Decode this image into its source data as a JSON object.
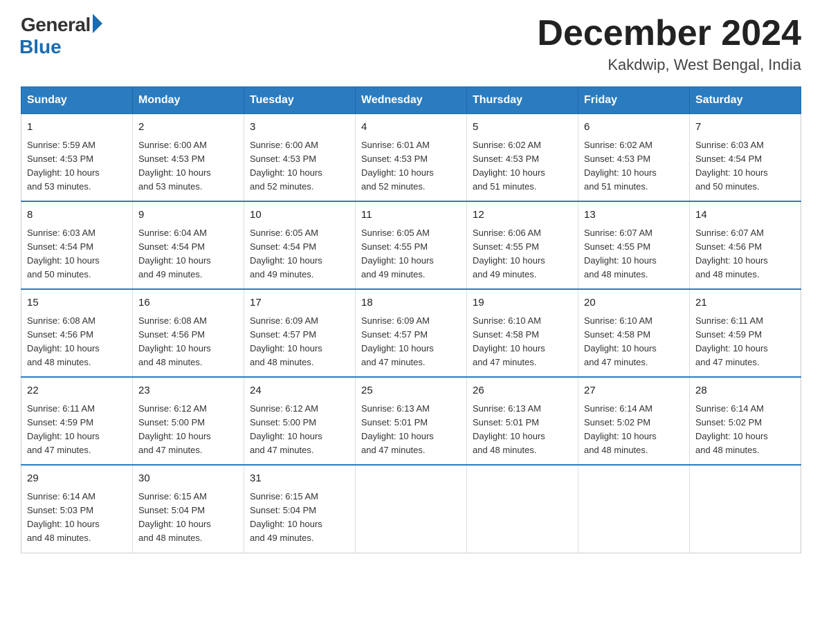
{
  "logo": {
    "general": "General",
    "blue": "Blue"
  },
  "title": "December 2024",
  "location": "Kakdwip, West Bengal, India",
  "days_of_week": [
    "Sunday",
    "Monday",
    "Tuesday",
    "Wednesday",
    "Thursday",
    "Friday",
    "Saturday"
  ],
  "weeks": [
    [
      {
        "day": "1",
        "sunrise": "5:59 AM",
        "sunset": "4:53 PM",
        "daylight": "10 hours and 53 minutes."
      },
      {
        "day": "2",
        "sunrise": "6:00 AM",
        "sunset": "4:53 PM",
        "daylight": "10 hours and 53 minutes."
      },
      {
        "day": "3",
        "sunrise": "6:00 AM",
        "sunset": "4:53 PM",
        "daylight": "10 hours and 52 minutes."
      },
      {
        "day": "4",
        "sunrise": "6:01 AM",
        "sunset": "4:53 PM",
        "daylight": "10 hours and 52 minutes."
      },
      {
        "day": "5",
        "sunrise": "6:02 AM",
        "sunset": "4:53 PM",
        "daylight": "10 hours and 51 minutes."
      },
      {
        "day": "6",
        "sunrise": "6:02 AM",
        "sunset": "4:53 PM",
        "daylight": "10 hours and 51 minutes."
      },
      {
        "day": "7",
        "sunrise": "6:03 AM",
        "sunset": "4:54 PM",
        "daylight": "10 hours and 50 minutes."
      }
    ],
    [
      {
        "day": "8",
        "sunrise": "6:03 AM",
        "sunset": "4:54 PM",
        "daylight": "10 hours and 50 minutes."
      },
      {
        "day": "9",
        "sunrise": "6:04 AM",
        "sunset": "4:54 PM",
        "daylight": "10 hours and 49 minutes."
      },
      {
        "day": "10",
        "sunrise": "6:05 AM",
        "sunset": "4:54 PM",
        "daylight": "10 hours and 49 minutes."
      },
      {
        "day": "11",
        "sunrise": "6:05 AM",
        "sunset": "4:55 PM",
        "daylight": "10 hours and 49 minutes."
      },
      {
        "day": "12",
        "sunrise": "6:06 AM",
        "sunset": "4:55 PM",
        "daylight": "10 hours and 49 minutes."
      },
      {
        "day": "13",
        "sunrise": "6:07 AM",
        "sunset": "4:55 PM",
        "daylight": "10 hours and 48 minutes."
      },
      {
        "day": "14",
        "sunrise": "6:07 AM",
        "sunset": "4:56 PM",
        "daylight": "10 hours and 48 minutes."
      }
    ],
    [
      {
        "day": "15",
        "sunrise": "6:08 AM",
        "sunset": "4:56 PM",
        "daylight": "10 hours and 48 minutes."
      },
      {
        "day": "16",
        "sunrise": "6:08 AM",
        "sunset": "4:56 PM",
        "daylight": "10 hours and 48 minutes."
      },
      {
        "day": "17",
        "sunrise": "6:09 AM",
        "sunset": "4:57 PM",
        "daylight": "10 hours and 48 minutes."
      },
      {
        "day": "18",
        "sunrise": "6:09 AM",
        "sunset": "4:57 PM",
        "daylight": "10 hours and 47 minutes."
      },
      {
        "day": "19",
        "sunrise": "6:10 AM",
        "sunset": "4:58 PM",
        "daylight": "10 hours and 47 minutes."
      },
      {
        "day": "20",
        "sunrise": "6:10 AM",
        "sunset": "4:58 PM",
        "daylight": "10 hours and 47 minutes."
      },
      {
        "day": "21",
        "sunrise": "6:11 AM",
        "sunset": "4:59 PM",
        "daylight": "10 hours and 47 minutes."
      }
    ],
    [
      {
        "day": "22",
        "sunrise": "6:11 AM",
        "sunset": "4:59 PM",
        "daylight": "10 hours and 47 minutes."
      },
      {
        "day": "23",
        "sunrise": "6:12 AM",
        "sunset": "5:00 PM",
        "daylight": "10 hours and 47 minutes."
      },
      {
        "day": "24",
        "sunrise": "6:12 AM",
        "sunset": "5:00 PM",
        "daylight": "10 hours and 47 minutes."
      },
      {
        "day": "25",
        "sunrise": "6:13 AM",
        "sunset": "5:01 PM",
        "daylight": "10 hours and 47 minutes."
      },
      {
        "day": "26",
        "sunrise": "6:13 AM",
        "sunset": "5:01 PM",
        "daylight": "10 hours and 48 minutes."
      },
      {
        "day": "27",
        "sunrise": "6:14 AM",
        "sunset": "5:02 PM",
        "daylight": "10 hours and 48 minutes."
      },
      {
        "day": "28",
        "sunrise": "6:14 AM",
        "sunset": "5:02 PM",
        "daylight": "10 hours and 48 minutes."
      }
    ],
    [
      {
        "day": "29",
        "sunrise": "6:14 AM",
        "sunset": "5:03 PM",
        "daylight": "10 hours and 48 minutes."
      },
      {
        "day": "30",
        "sunrise": "6:15 AM",
        "sunset": "5:04 PM",
        "daylight": "10 hours and 48 minutes."
      },
      {
        "day": "31",
        "sunrise": "6:15 AM",
        "sunset": "5:04 PM",
        "daylight": "10 hours and 49 minutes."
      },
      null,
      null,
      null,
      null
    ]
  ],
  "labels": {
    "sunrise": "Sunrise:",
    "sunset": "Sunset:",
    "daylight": "Daylight:"
  }
}
